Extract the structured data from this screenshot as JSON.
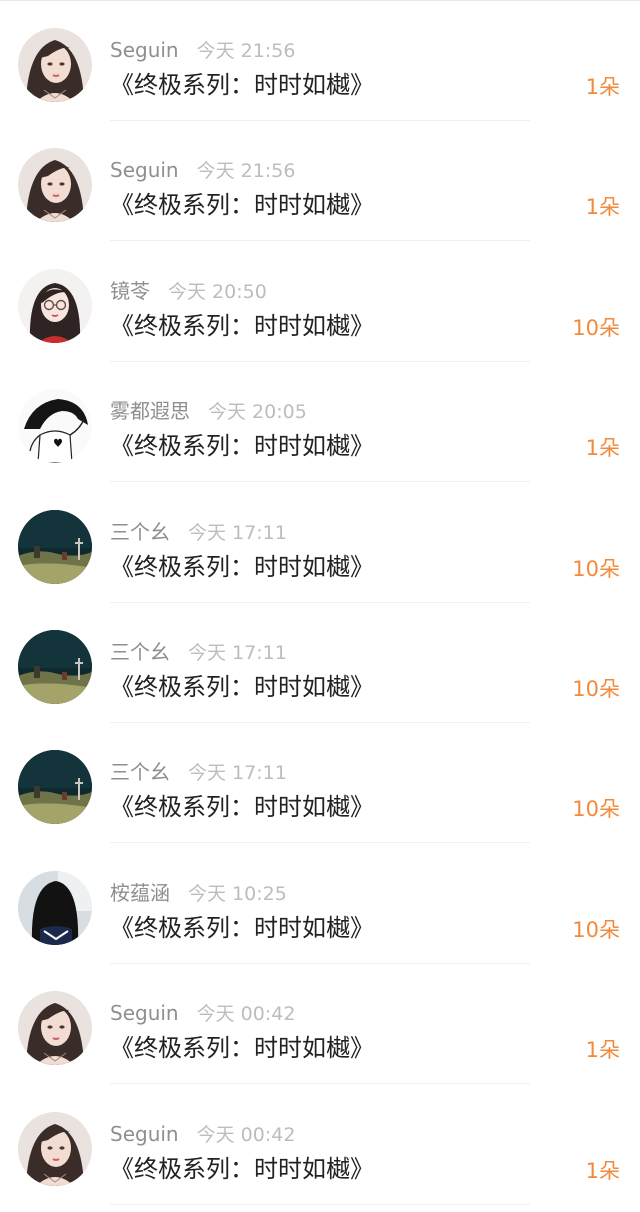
{
  "colors": {
    "accent_orange": "#f28a3c",
    "username_gray": "#8f8f8f",
    "time_gray": "#bdbdbd",
    "title_text": "#222222"
  },
  "gifts": [
    {
      "user": "Seguin",
      "time": "今天 21:56",
      "title": "《终极系列：时时如樾》",
      "amount": "1朵",
      "avatar": "girl-portrait-icon"
    },
    {
      "user": "Seguin",
      "time": "今天 21:56",
      "title": "《终极系列：时时如樾》",
      "amount": "1朵",
      "avatar": "girl-portrait-icon"
    },
    {
      "user": "镜苓",
      "time": "今天 20:50",
      "title": "《终极系列：时时如樾》",
      "amount": "10朵",
      "avatar": "girl-glasses-icon"
    },
    {
      "user": "雾都遐思",
      "time": "今天 20:05",
      "title": "《终极系列：时时如樾》",
      "amount": "1朵",
      "avatar": "sketch-heart-icon"
    },
    {
      "user": "三个幺",
      "time": "今天 17:11",
      "title": "《终极系列：时时如樾》",
      "amount": "10朵",
      "avatar": "night-field-icon"
    },
    {
      "user": "三个幺",
      "time": "今天 17:11",
      "title": "《终极系列：时时如樾》",
      "amount": "10朵",
      "avatar": "night-field-icon"
    },
    {
      "user": "三个幺",
      "time": "今天 17:11",
      "title": "《终极系列：时时如樾》",
      "amount": "10朵",
      "avatar": "night-field-icon"
    },
    {
      "user": "桉蕴涵",
      "time": "今天 10:25",
      "title": "《终极系列：时时如樾》",
      "amount": "10朵",
      "avatar": "girl-dark-hair-icon"
    },
    {
      "user": "Seguin",
      "time": "今天 00:42",
      "title": "《终极系列：时时如樾》",
      "amount": "1朵",
      "avatar": "girl-portrait-icon"
    },
    {
      "user": "Seguin",
      "time": "今天 00:42",
      "title": "《终极系列：时时如樾》",
      "amount": "1朵",
      "avatar": "girl-portrait-icon"
    }
  ]
}
